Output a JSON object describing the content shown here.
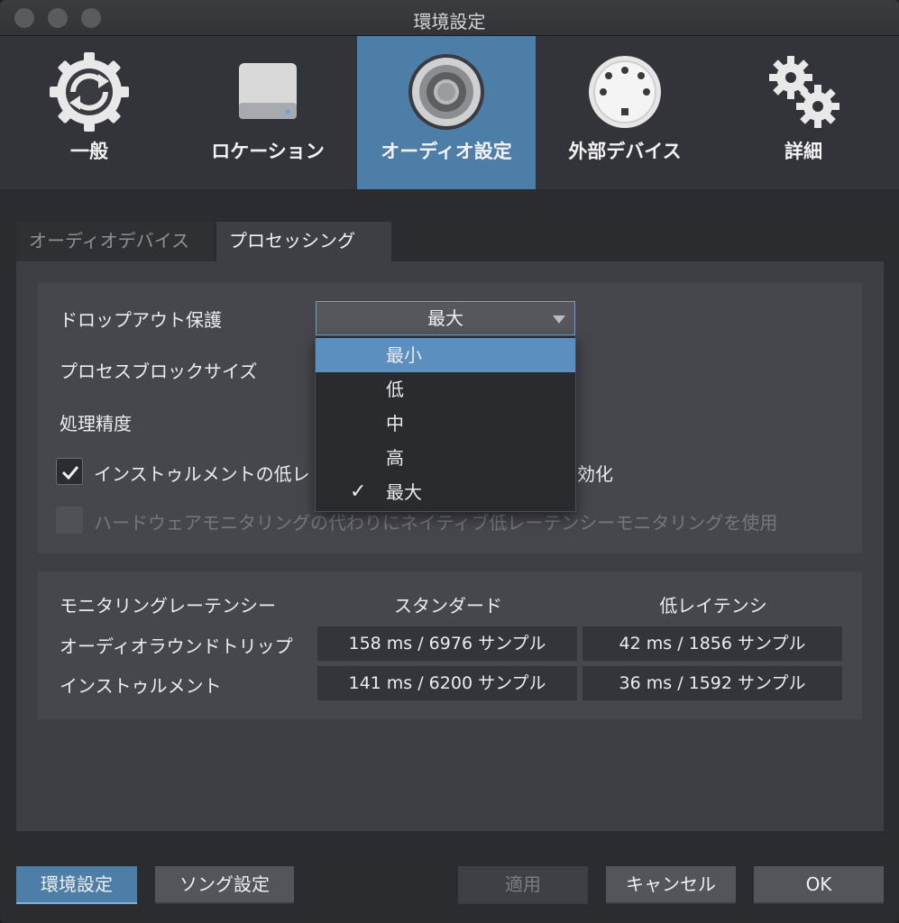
{
  "window": {
    "title": "環境設定"
  },
  "toolbar": {
    "items": [
      {
        "label": "一般",
        "icon": "sync-gear-icon"
      },
      {
        "label": "ロケーション",
        "icon": "drive-icon"
      },
      {
        "label": "オーディオ設定",
        "icon": "speaker-icon",
        "active": true
      },
      {
        "label": "外部デバイス",
        "icon": "midi-port-icon"
      },
      {
        "label": "詳細",
        "icon": "gears-icon"
      }
    ]
  },
  "tabs": {
    "items": [
      {
        "label": "オーディオデバイス"
      },
      {
        "label": "プロセッシング",
        "active": true
      }
    ]
  },
  "processing": {
    "dropout_label": "ドロップアウト保護",
    "dropout_value": "最大",
    "block_size_label": "プロセスブロックサイズ",
    "precision_label": "処理精度",
    "instrument_low_latency_label": "インストゥルメントの低レ",
    "instrument_low_latency_tail": "効化",
    "native_monitoring_label": "ハードウェアモニタリングの代わりにネイティブ低レーテンシーモニタリングを使用"
  },
  "dropdown": {
    "options": [
      {
        "label": "最小",
        "highlighted": true
      },
      {
        "label": "低"
      },
      {
        "label": "中"
      },
      {
        "label": "高"
      },
      {
        "label": "最大",
        "checked": true
      }
    ],
    "check_glyph": "✓"
  },
  "latency": {
    "header": "モニタリングレーテンシー",
    "col_standard": "スタンダード",
    "col_low": "低レイテンシ",
    "rows": [
      {
        "label": "オーディオラウンドトリップ",
        "standard": "158 ms / 6976 サンプル",
        "low": "42 ms / 1856 サンプル"
      },
      {
        "label": "インストゥルメント",
        "standard": "141 ms / 6200 サンプル",
        "low": "36 ms / 1592 サンプル"
      }
    ]
  },
  "footer": {
    "preferences": "環境設定",
    "song_settings": "ソング設定",
    "apply": "適用",
    "cancel": "キャンセル",
    "ok": "OK"
  },
  "colors": {
    "accent": "#4d7ea8",
    "highlight": "#5b8fbf"
  }
}
